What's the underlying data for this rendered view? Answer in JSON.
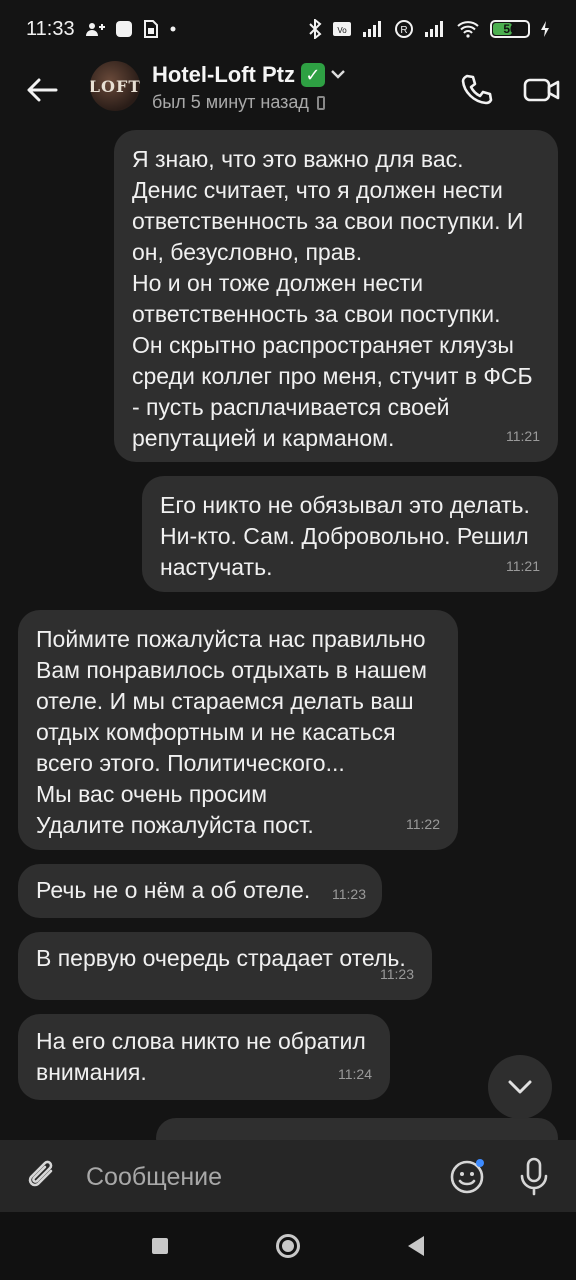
{
  "status_bar": {
    "time": "11:33",
    "battery_level": "56",
    "icons": [
      "person-add-icon",
      "notification-icon",
      "sim-icon",
      "dot-icon",
      "bluetooth-icon",
      "volte-icon",
      "signal-icon",
      "r-icon",
      "signal-icon",
      "wifi-icon",
      "battery-icon",
      "charging-icon"
    ]
  },
  "header": {
    "contact_name": "Hotel-Loft Ptz",
    "verified_badge": "✅",
    "last_seen": "был 5 минут назад",
    "avatar_text": "LOFT"
  },
  "messages": [
    {
      "direction": "outgoing",
      "text": "Я знаю, что это важно для вас.\nДенис считает, что я должен нести ответственность за свои поступки. И он, безусловно, прав.\nНо и он тоже должен нести ответственность за свои поступки.\nОн скрытно распространяет кляузы среди коллег про меня, стучит в ФСБ - пусть расплачивается своей репутацией и карманом.",
      "time": "11:21"
    },
    {
      "direction": "outgoing",
      "text": "Его никто не обязывал это делать. Ни-кто. Сам. Добровольно. Решил настучать.",
      "time": "11:21"
    },
    {
      "direction": "incoming",
      "text": "Поймите пожалуйста нас правильно\nВам понравилось отдыхать в нашем отеле. И мы стараемся делать ваш отдых комфортным и не касаться всего этого. Политического...\nМы вас очень просим\nУдалите пожалуйста пост.",
      "time": "11:22"
    },
    {
      "direction": "incoming",
      "text": "Речь не о нём а об отеле.",
      "time": "11:23"
    },
    {
      "direction": "incoming",
      "text": "В первую очередь страдает отель.",
      "time": "11:23"
    },
    {
      "direction": "incoming",
      "text": "На его слова никто не обратил внимания.",
      "time": "11:24"
    }
  ],
  "composer": {
    "placeholder": "Сообщение"
  }
}
